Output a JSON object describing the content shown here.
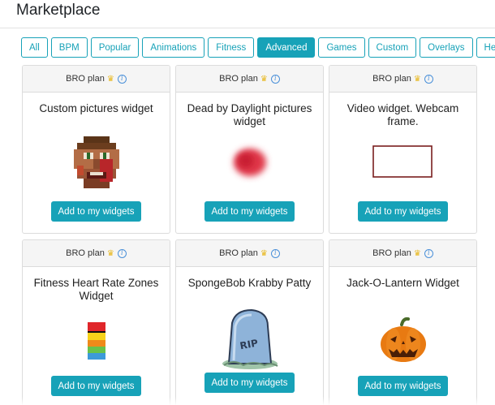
{
  "page": {
    "title": "Marketplace"
  },
  "tabs": [
    {
      "label": "All",
      "active": false
    },
    {
      "label": "BPM",
      "active": false
    },
    {
      "label": "Popular",
      "active": false
    },
    {
      "label": "Animations",
      "active": false
    },
    {
      "label": "Fitness",
      "active": false
    },
    {
      "label": "Advanced",
      "active": true
    },
    {
      "label": "Games",
      "active": false
    },
    {
      "label": "Custom",
      "active": false
    },
    {
      "label": "Overlays",
      "active": false
    },
    {
      "label": "Hearts",
      "active": false
    }
  ],
  "cards": [
    {
      "plan": "BRO plan",
      "title": "Custom pictures widget",
      "image": "pixel-face",
      "button": "Add to my widgets"
    },
    {
      "plan": "BRO plan",
      "title": "Dead by Daylight pictures widget",
      "image": "red-blur",
      "button": "Add to my widgets"
    },
    {
      "plan": "BRO plan",
      "title": "Video widget. Webcam frame.",
      "image": "webcam-frame",
      "button": "Add to my widgets"
    },
    {
      "plan": "BRO plan",
      "title": "Fitness Heart Rate Zones Widget",
      "image": "hr-zones",
      "button": "Add to my widgets"
    },
    {
      "plan": "BRO plan",
      "title": "SpongeBob Krabby Patty",
      "image": "tombstone",
      "button": "Add to my widgets"
    },
    {
      "plan": "BRO plan",
      "title": "Jack-O-Lantern Widget",
      "image": "pumpkin",
      "button": "Add to my widgets"
    }
  ],
  "colors": {
    "accent": "#17a2b8",
    "crown": "#e8b820",
    "info": "#4a90d9"
  }
}
